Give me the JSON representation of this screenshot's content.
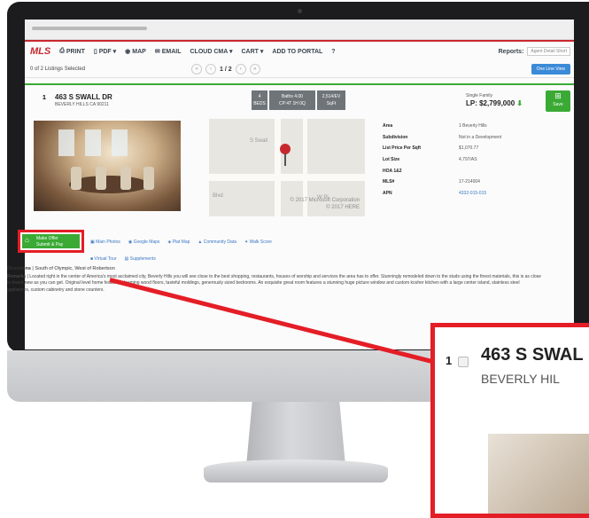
{
  "toolbar": {
    "logo": "MLS",
    "items": [
      "PRINT",
      "PDF ▾",
      "MAP",
      "EMAIL",
      "CLOUD CMA ▾",
      "CART ▾",
      "ADD TO PORTAL",
      "?"
    ],
    "reports_label": "Reports:",
    "reports_value": "Agent Detail Short"
  },
  "nav": {
    "selected": "0 of 2 Listings Selected",
    "page": "1 / 2",
    "grid_button": "One Line View"
  },
  "listing": {
    "number": "1",
    "address": "463 S SWALL DR",
    "city": "BEVERLY HILLS CA 90211",
    "beds": "4",
    "beds_label": "BEDS",
    "baths": "Baths 4.00",
    "baths_detail": "CP:4T 1H 0Q",
    "sqft": "2,514/EV",
    "sqft_label": "SqFt",
    "type": "Single Family",
    "price": "LP: $2,799,000",
    "price_arrow": "⬇",
    "save_label": "Save"
  },
  "map": {
    "copyright1": "© 2017 Microsoft Corporation",
    "copyright2": "© 2017 HERE",
    "street1": "S Swall",
    "street2": "Blvd",
    "street3": "W Pi"
  },
  "facts": [
    {
      "label": "Area",
      "value": "1 Beverly Hills"
    },
    {
      "label": "Subdivision",
      "value": "Not in a Development"
    },
    {
      "label": "List Price Per Sqft",
      "value": "$1,070.77"
    },
    {
      "label": "Lot Size",
      "value": "4,797/AS"
    },
    {
      "label": "HOA 1&2",
      "value": ""
    },
    {
      "label": "MLS#",
      "value": "17-214004"
    },
    {
      "label": "APN",
      "value": "4332-015-015"
    }
  ],
  "actions": {
    "more_offer": "Make Offer",
    "more_offer_sub": "Submit & Pay",
    "links": [
      "Main Photos",
      "Google Maps",
      "Plat Map",
      "Community Data",
      "Walk Score"
    ],
    "links2": [
      "Virtual Tour",
      "Supplements"
    ]
  },
  "directions": {
    "label": "Directions",
    "text": "South of Olympic, West of Robertson"
  },
  "remarks": {
    "label": "Remarks",
    "text": "Located right in the center of America's most acclaimed city, Beverly Hills you will see close to the best shopping, restaurants, houses of worship and services the area has to offer. Stunningly remodeled down to the studs using the finest materials, this is as close to brand new as you can get. Original level home features gleaming wood floors, tasteful moldings, generously sized bedrooms. An exquisite great room features a stunning huge picture window and custom kosher kitchen with a large center island, stainless steel appliances, custom cabinetry and stone counters."
  },
  "zoom": {
    "number": "1",
    "address": "463 S SWAL",
    "city": "BEVERLY HIL"
  },
  "colors": {
    "brand_red": "#c7282e",
    "callout_red": "#e41e26",
    "green": "#3aaa35",
    "link_blue": "#3b78c4"
  }
}
